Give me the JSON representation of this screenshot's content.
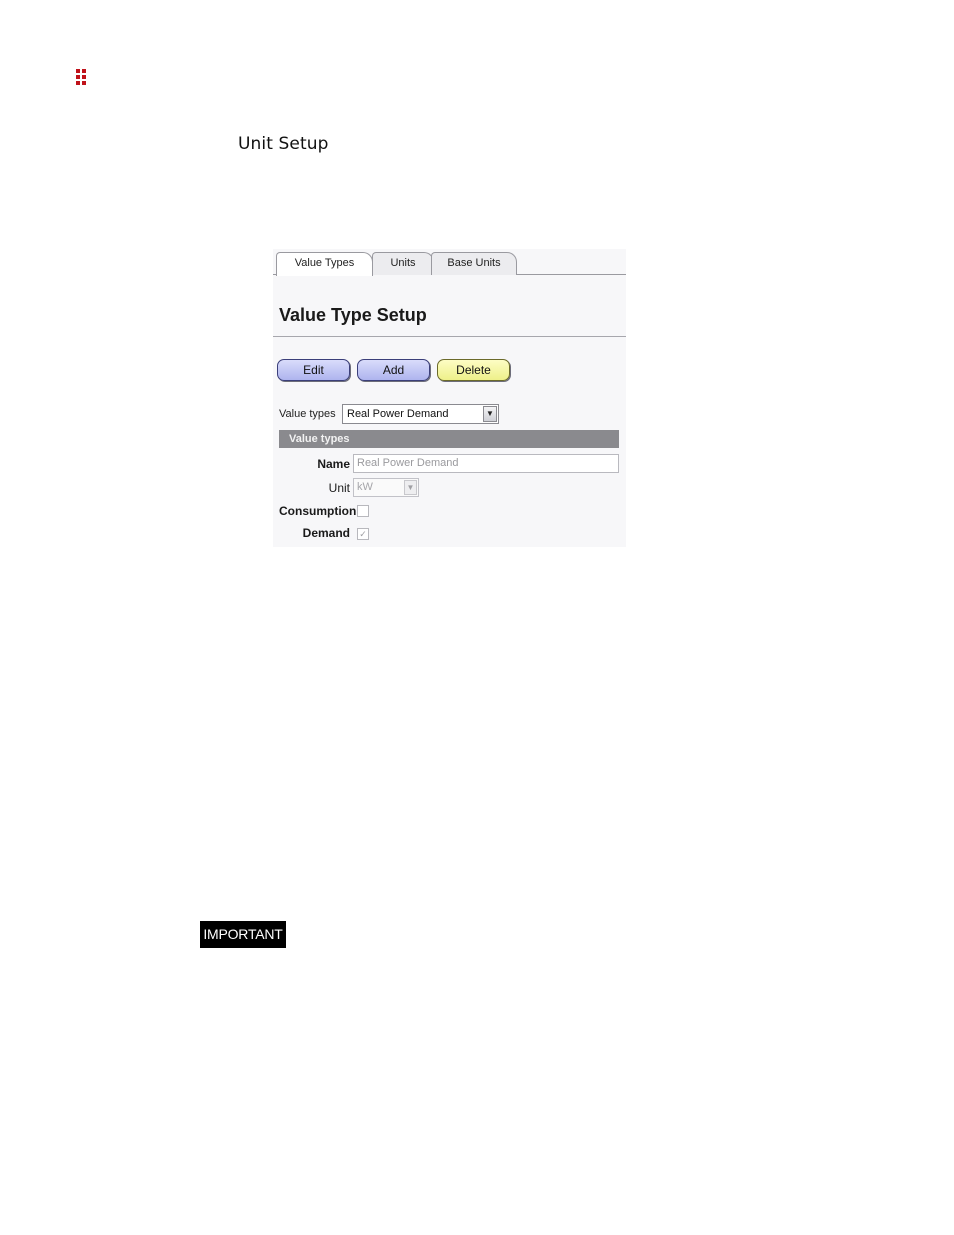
{
  "document": {
    "heading": "Unit Setup",
    "important_label": "IMPORTANT",
    "logo_color": "#c0121a"
  },
  "app": {
    "tabs": [
      {
        "label": "Value Types",
        "active": true
      },
      {
        "label": "Units",
        "active": false
      },
      {
        "label": "Base Units",
        "active": false
      }
    ],
    "section_title": "Value Type Setup",
    "buttons": {
      "edit": "Edit",
      "add": "Add",
      "delete": "Delete"
    },
    "value_types": {
      "label": "Value types",
      "selected": "Real Power Demand"
    },
    "group_header": "Value types",
    "form": {
      "name_label": "Name",
      "name_value": "Real Power Demand",
      "unit_label": "Unit",
      "unit_value": "kW",
      "consumption_label": "Consumption",
      "consumption_checked": false,
      "demand_label": "Demand",
      "demand_checked": true
    },
    "colors": {
      "blue_button": "#aeb4ee",
      "yellow_button": "#eef08a",
      "group_header_bg": "#8a8a8e"
    }
  }
}
